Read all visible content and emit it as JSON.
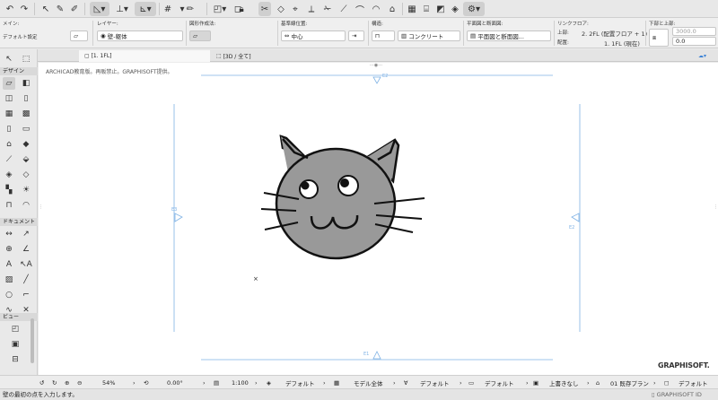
{
  "colors": {
    "guide": "#7fb2e5",
    "cat_fill": "#999999",
    "cat_stroke": "#111111",
    "selected_tool": "#cfcfcf"
  },
  "infobox": {
    "main_label": "メイン:",
    "default_settings": "デフォルト設定",
    "layer_label": "レイヤー:",
    "layer_value": "壁-躯体",
    "geometry_label": "図形作成法:",
    "ref_line_label": "基準線位置:",
    "ref_line_value": "中心",
    "structure_label": "構造:",
    "structure_value": "コンクリート",
    "floorplan_label": "平面図と断面図:",
    "floorplan_value": "平面図と断面図...",
    "link_floor_label": "リンクフロア:",
    "top_label": "上部:",
    "top_value": "2. 2FL (配置フロア + 1)",
    "home_label": "配置:",
    "home_value": "1. 1FL (現在)",
    "offset_label": "下部と上部:",
    "offset_top": "3000.0",
    "offset_bottom": "0.0"
  },
  "tabs": [
    {
      "label": "[1. 1FL]"
    },
    {
      "label": "[3D / 全て]"
    }
  ],
  "left_panel": {
    "sections": [
      "デザイン",
      "ドキュメント",
      "ビュー"
    ]
  },
  "canvas": {
    "watermark": "ARCHICAD教育版。再販禁止。GRAPHISOFT提供。",
    "marker_top": "E2",
    "marker_left": "E3",
    "marker_right": "E2",
    "marker_bottom": "E1"
  },
  "status": {
    "zoom": "54%",
    "angle": "0.00°",
    "scale": "1:100",
    "layer_combo": "デフォルト",
    "model_view": "モデル全体",
    "pen_set": "デフォルト",
    "dimension": "デフォルト",
    "override": "上書きなし",
    "renovation": "01 既存プラン",
    "last": "デフォルト"
  },
  "brand": "GRAPHISOFT.",
  "graphisoft_id": "GRAPHISOFT ID",
  "hint": "壁の最初の点を入力します。"
}
